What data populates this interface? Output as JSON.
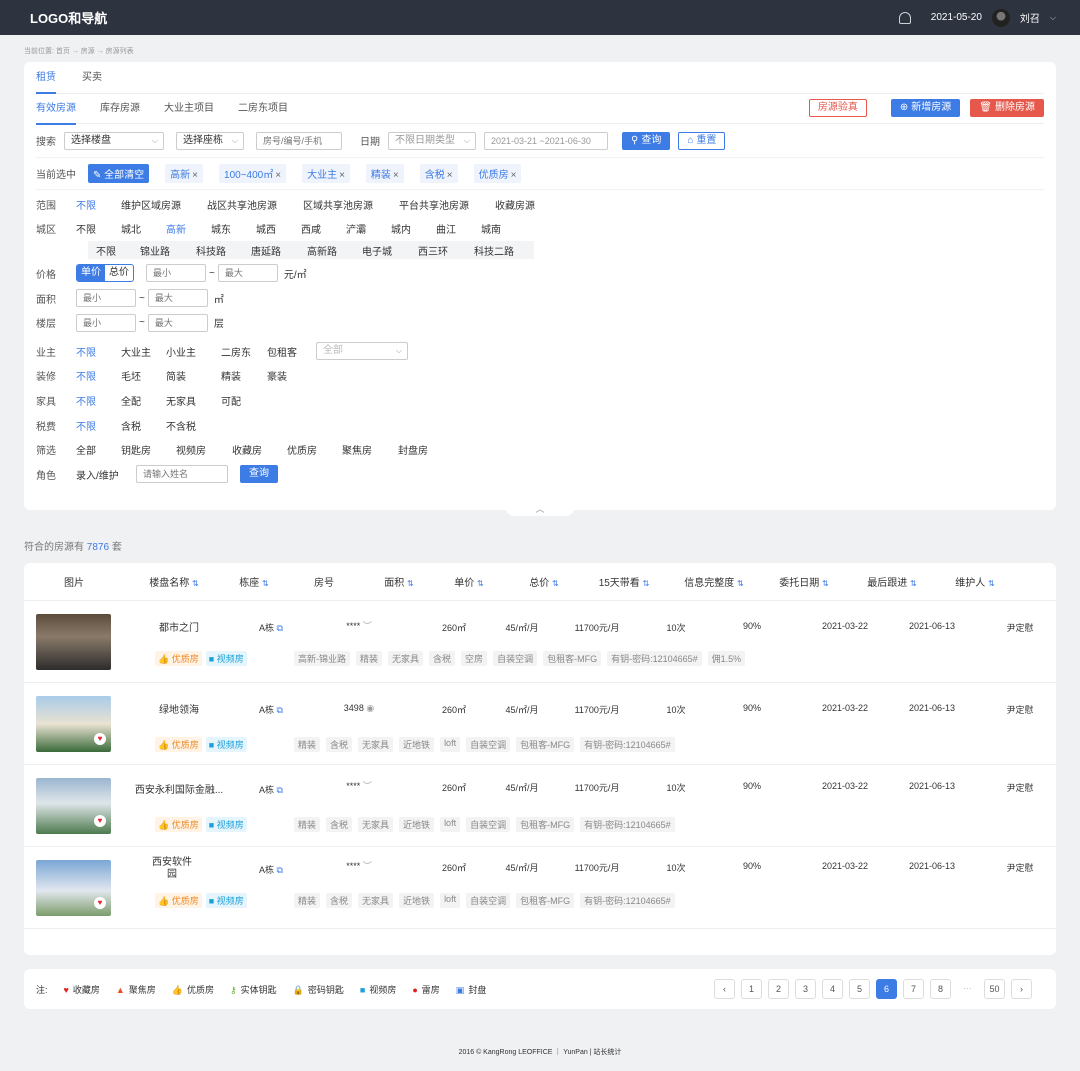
{
  "header": {
    "logo": "LOGO和导航",
    "date": "2021-05-20",
    "user": "刘召"
  },
  "breadcrumb": "当前位置: 首页 → 房源 → 房源列表",
  "tabs_top": [
    "租赁",
    "买卖"
  ],
  "tabs_sub": [
    "有效房源",
    "库存房源",
    "大业主项目",
    "二房东项目"
  ],
  "actions": {
    "verify": "房源验真",
    "add": "新增房源",
    "delete": "删除房源"
  },
  "search": {
    "label": "搜索",
    "building": "选择楼盘",
    "block": "选择座栋",
    "room_placeholder": "房号/编号/手机",
    "date_label": "日期",
    "date_type": "不限日期类型",
    "date_range": "2021-03-21 ~2021-06-30",
    "query": "查询",
    "reset": "重置"
  },
  "selected": {
    "label": "当前选中",
    "clear": "全部清空",
    "chips": [
      "高新",
      "100~400㎡",
      "大业主",
      "精装",
      "含税",
      "优质房"
    ]
  },
  "filters": {
    "scope": {
      "k": "范围",
      "opts": [
        "不限",
        "维护区域房源",
        "战区共享池房源",
        "区域共享池房源",
        "平台共享池房源",
        "收藏房源"
      ]
    },
    "district": {
      "k": "城区",
      "opts": [
        "不限",
        "城北",
        "高新",
        "城东",
        "城西",
        "西咸",
        "浐灞",
        "城内",
        "曲江",
        "城南"
      ]
    },
    "subarea": [
      "不限",
      "锦业路",
      "科技路",
      "唐延路",
      "高新路",
      "电子城",
      "西三环",
      "科技二路"
    ],
    "price": {
      "k": "价格",
      "unit_price": "单价",
      "total_price": "总价",
      "min": "最小",
      "max": "最大",
      "unit": "元/㎡"
    },
    "area": {
      "k": "面积",
      "min": "最小",
      "max": "最大",
      "unit": "㎡"
    },
    "floor": {
      "k": "楼层",
      "min": "最小",
      "max": "最大",
      "unit": "层"
    },
    "owner": {
      "k": "业主",
      "opts": [
        "不限",
        "大业主",
        "小业主",
        "二房东",
        "包租客"
      ],
      "select": "全部"
    },
    "decor": {
      "k": "装修",
      "opts": [
        "不限",
        "毛坯",
        "简装",
        "精装",
        "豪装"
      ]
    },
    "furniture": {
      "k": "家具",
      "opts": [
        "不限",
        "全配",
        "无家具",
        "可配"
      ]
    },
    "tax": {
      "k": "税费",
      "opts": [
        "不限",
        "含税",
        "不含税"
      ]
    },
    "screen": {
      "k": "筛选",
      "opts": [
        "全部",
        "钥匙房",
        "视频房",
        "收藏房",
        "优质房",
        "聚焦房",
        "封盘房"
      ]
    },
    "role": {
      "k": "角色",
      "opt": "录入/维护",
      "placeholder": "请输入姓名",
      "query": "查询"
    }
  },
  "result": {
    "prefix": "符合的房源有",
    "count": "7876",
    "suffix": "套"
  },
  "columns": [
    "图片",
    "楼盘名称",
    "栋座",
    "房号",
    "面积",
    "单价",
    "总价",
    "15天带看",
    "信息完整度",
    "委托日期",
    "最后跟进",
    "维护人"
  ],
  "rows": [
    {
      "name": "都市之门",
      "block": "A栋",
      "room": "****",
      "area": "260㎡",
      "unit_price": "45/㎡/月",
      "total": "11700元/月",
      "visits": "10次",
      "complete": "90%",
      "entrust": "2021-03-22",
      "follow": "2021-06-13",
      "agent": "尹定慰",
      "badge1": "优质房",
      "badge2": "视频房",
      "tags": [
        "高新-锦业路",
        "精装",
        "无家具",
        "含税",
        "空房",
        "自装空调",
        "包租客-MFG",
        "有钥-密码:12104665#",
        "佣1.5%"
      ]
    },
    {
      "name": "绿地领海",
      "block": "A栋",
      "room": "3498",
      "area": "260㎡",
      "unit_price": "45/㎡/月",
      "total": "11700元/月",
      "visits": "10次",
      "complete": "90%",
      "entrust": "2021-03-22",
      "follow": "2021-06-13",
      "agent": "尹定慰",
      "badge1": "优质房",
      "badge2": "视频房",
      "tags": [
        "精装",
        "含税",
        "无家具",
        "近地铁",
        "loft",
        "自装空调",
        "包租客-MFG",
        "有钥-密码:12104665#"
      ]
    },
    {
      "name": "西安永利国际金融...",
      "block": "A栋",
      "room": "****",
      "area": "260㎡",
      "unit_price": "45/㎡/月",
      "total": "11700元/月",
      "visits": "10次",
      "complete": "90%",
      "entrust": "2021-03-22",
      "follow": "2021-06-13",
      "agent": "尹定慰",
      "badge1": "优质房",
      "badge2": "视频房",
      "tags": [
        "精装",
        "含税",
        "无家具",
        "近地铁",
        "loft",
        "自装空调",
        "包租客-MFG",
        "有钥-密码:12104665#"
      ]
    },
    {
      "name": "西安软件园",
      "block": "A栋",
      "room": "****",
      "area": "260㎡",
      "unit_price": "45/㎡/月",
      "total": "11700元/月",
      "visits": "10次",
      "complete": "90%",
      "entrust": "2021-03-22",
      "follow": "2021-06-13",
      "agent": "尹定慰",
      "badge1": "优质房",
      "badge2": "视频房",
      "tags": [
        "精装",
        "含税",
        "无家具",
        "近地铁",
        "loft",
        "自装空调",
        "包租客-MFG",
        "有钥-密码:12104665#"
      ]
    }
  ],
  "legend": {
    "label": "注:",
    "items": [
      "收藏房",
      "聚焦房",
      "优质房",
      "实体钥匙",
      "密码钥匙",
      "视频房",
      "雷房",
      "封盘"
    ]
  },
  "pager": [
    "1",
    "2",
    "3",
    "4",
    "5",
    "6",
    "7",
    "8",
    "50"
  ],
  "footer": "2016 © KangRong LEOFFICE ｜ YunPan | 站长统计",
  "colors": {
    "accent": "#3d7be5",
    "danger": "#e6584c",
    "topbar": "#2d333f"
  }
}
